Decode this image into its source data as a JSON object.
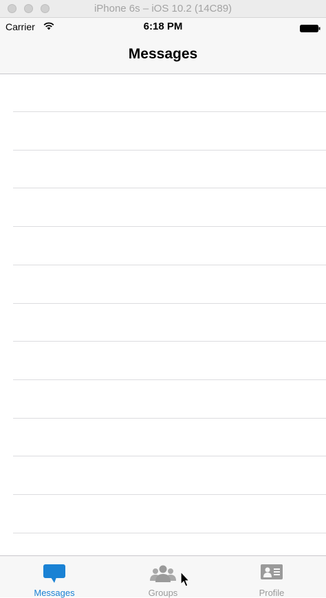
{
  "window": {
    "title": "iPhone 6s – iOS 10.2 (14C89)"
  },
  "status_bar": {
    "carrier": "Carrier",
    "time": "6:18 PM"
  },
  "navbar": {
    "title": "Messages"
  },
  "table": {
    "rows": [
      "",
      "",
      "",
      "",
      "",
      "",
      "",
      "",
      "",
      "",
      "",
      "",
      ""
    ]
  },
  "tab_bar": {
    "active_color": "#1a82d4",
    "inactive_color": "#9a9a9a",
    "tabs": [
      {
        "label": "Messages",
        "icon": "speech-bubble-icon",
        "selected": true
      },
      {
        "label": "Groups",
        "icon": "group-icon",
        "selected": false
      },
      {
        "label": "Profile",
        "icon": "contact-card-icon",
        "selected": false
      }
    ]
  }
}
